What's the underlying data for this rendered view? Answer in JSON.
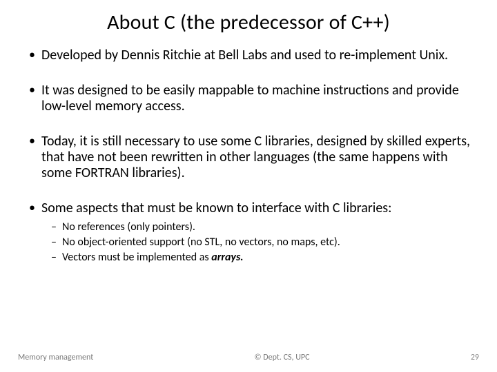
{
  "title": "About C (the predecessor of C++)",
  "bullets": [
    {
      "text": "Developed by Dennis Ritchie at Bell Labs and used to re-implement Unix."
    },
    {
      "text": "It was designed to be easily mappable to machine instructions and provide low-level memory access."
    },
    {
      "text": "Today, it is still necessary to use some C libraries, designed by skilled experts, that have not been rewritten in other languages (the same happens with some FORTRAN libraries)."
    },
    {
      "text": "Some aspects that must be known to interface with C libraries:",
      "sub": [
        "No references (only pointers).",
        "No object-oriented support (no STL, no vectors, no maps, etc).",
        "Vectors must be implemented as "
      ],
      "sub_emph_tail": [
        "",
        "",
        "arrays."
      ]
    }
  ],
  "footer": {
    "left": "Memory management",
    "center": "© Dept. CS, UPC",
    "page": "29"
  }
}
